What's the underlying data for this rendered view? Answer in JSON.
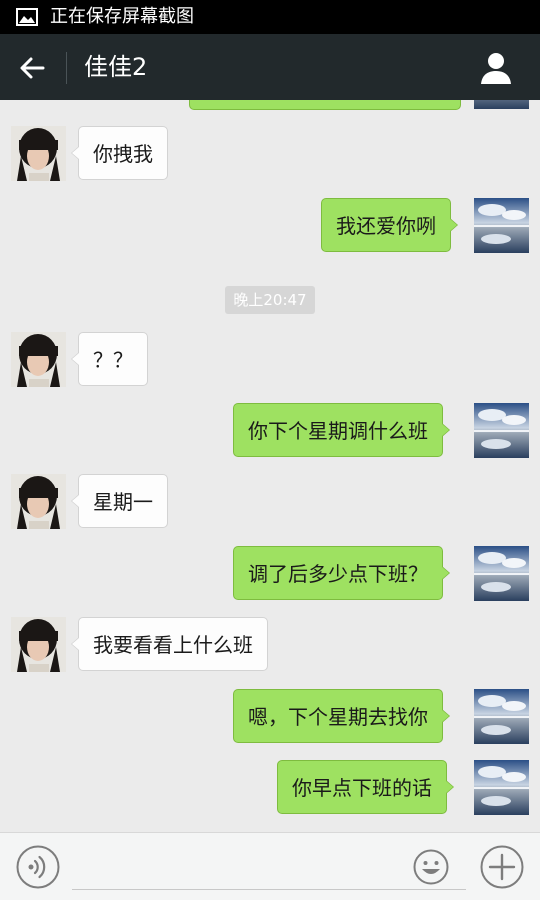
{
  "status_bar": {
    "text": "正在保存屏幕截图",
    "icon": "image-icon"
  },
  "header": {
    "title": "佳佳2",
    "back_icon": "back-arrow-icon",
    "profile_icon": "person-icon"
  },
  "timestamp": "晚上20:47",
  "messages": [
    {
      "side": "out",
      "text": ""
    },
    {
      "side": "in",
      "text": "你拽我"
    },
    {
      "side": "out",
      "text": "我还爱你咧"
    },
    {
      "side": "in",
      "text": "？？"
    },
    {
      "side": "out",
      "text": "你下个星期调什么班"
    },
    {
      "side": "in",
      "text": "星期一"
    },
    {
      "side": "out",
      "text": "调了后多少点下班？"
    },
    {
      "side": "in",
      "text": "我要看看上什么班"
    },
    {
      "side": "out",
      "text": "嗯，下个星期去找你"
    },
    {
      "side": "out",
      "text": "你早点下班的话"
    }
  ],
  "input_bar": {
    "voice_icon": "voice-icon",
    "emoji_icon": "emoji-icon",
    "plus_icon": "plus-icon",
    "value": ""
  },
  "colors": {
    "out_bubble": "#9ee161",
    "in_bubble": "#fdfdfd",
    "header": "#22292c"
  }
}
